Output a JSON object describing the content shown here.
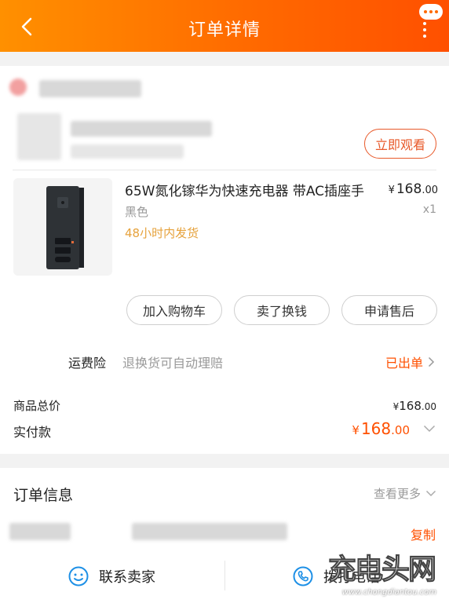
{
  "header": {
    "title": "订单详情"
  },
  "live": {
    "label": "立即观看"
  },
  "product": {
    "name": "65W氮化镓华为快速充电器 带AC插座手",
    "price_symbol": "¥",
    "price_int": "168",
    "price_dec": ".00",
    "color": "黑色",
    "qty": "x1",
    "ship_note": "48小时内发货"
  },
  "actions": {
    "add_cart": "加入购物车",
    "resell": "卖了换钱",
    "after_sale": "申请售后"
  },
  "insurance": {
    "label": "运费险",
    "desc": "退换货可自动理赔",
    "status": "已出单"
  },
  "totals": {
    "subtotal_label": "商品总价",
    "subtotal_symbol": "¥",
    "subtotal_int": "168",
    "subtotal_dec": ".00",
    "paid_label": "实付款",
    "paid_symbol": "¥",
    "paid_int": "168",
    "paid_dec": ".00"
  },
  "order_info": {
    "title": "订单信息",
    "more": "查看更多",
    "copy": "复制"
  },
  "bottom_bar": {
    "contact": "联系卖家",
    "call": "拨打电话"
  },
  "watermark": {
    "big": "充电头网",
    "url": "www.chongdiantou.com"
  },
  "colors": {
    "accent": "#ff5000",
    "header_start": "#ff9000",
    "header_end": "#ff5000",
    "ship_note": "#e6a23c",
    "icon_blue": "#1e90e6"
  }
}
